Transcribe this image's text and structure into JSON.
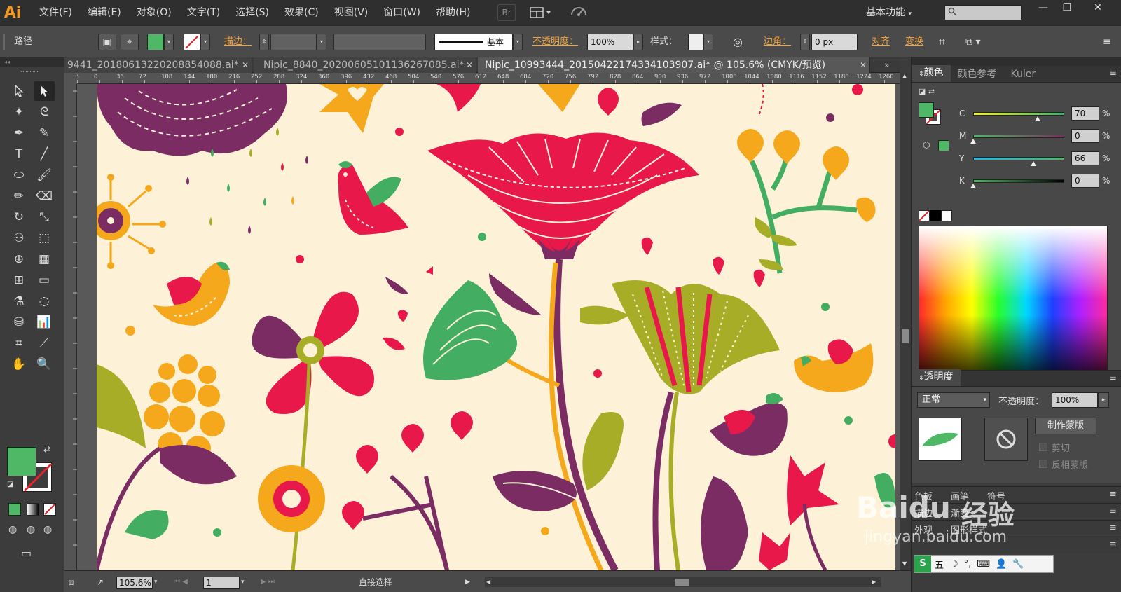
{
  "app": {
    "logo": "Ai",
    "workspace": "基本功能",
    "search_placeholder": ""
  },
  "menu": [
    "文件(F)",
    "编辑(E)",
    "对象(O)",
    "文字(T)",
    "选择(S)",
    "效果(C)",
    "视图(V)",
    "窗口(W)",
    "帮助(H)"
  ],
  "menu_icons": {
    "bridge": "Br",
    "arrange": "arrange-icon",
    "gpu": "gpu-icon"
  },
  "window_controls": [
    "—",
    "❐",
    "✕"
  ],
  "control": {
    "selection_type": "路径",
    "stroke_label": "描边：",
    "stroke_style": "基本",
    "opacity_label": "不透明度：",
    "opacity_value": "100%",
    "style_label": "样式：",
    "corner_label": "边角：",
    "corner_value": "0 px",
    "align_label": "对齐",
    "transform_label": "变换",
    "fill_color": "#4eb866"
  },
  "tabs": [
    {
      "label": "9441_20180613220208854088.ai*",
      "close": "✕"
    },
    {
      "label": "Nipic_8840_20200605101136267085.ai*",
      "close": "✕"
    },
    {
      "label": "Nipic_10993444_20150422174334103907.ai* @ 105.6% (CMYK/预览)",
      "close": "✕"
    }
  ],
  "ruler": {
    "top_ticks": [
      "36",
      "0",
      "36",
      "72",
      "108",
      "144",
      "180",
      "216",
      "252",
      "288",
      "324",
      "360",
      "396",
      "432",
      "468",
      "504",
      "540",
      "576",
      "612",
      "648",
      "684",
      "720",
      "756",
      "792",
      "828",
      "864",
      "900",
      "936",
      "972",
      "1008",
      "1044",
      "1080",
      "1116",
      "1152",
      "1188",
      "1224",
      "1260"
    ]
  },
  "statusbar": {
    "zoom": "105.6%",
    "artboard": "1",
    "tool_status": "直接选择"
  },
  "color_panel": {
    "tabs": [
      "颜色",
      "颜色参考",
      "Kuler"
    ],
    "channels": [
      {
        "name": "C",
        "value": "70",
        "unit": "%"
      },
      {
        "name": "M",
        "value": "0",
        "unit": "%"
      },
      {
        "name": "Y",
        "value": "66",
        "unit": "%"
      },
      {
        "name": "K",
        "value": "0",
        "unit": "%"
      }
    ],
    "fill": "#4eb866"
  },
  "transparency_panel": {
    "title": "透明度",
    "blend_mode": "正常",
    "opacity_label": "不透明度：",
    "opacity_value": "100%",
    "make_mask": "制作蒙版",
    "clip": "剪切",
    "invert_mask": "反相蒙版"
  },
  "collapsed_panels": [
    {
      "tabs": [
        "色板",
        "画笔",
        "符号"
      ]
    },
    {
      "tabs": [
        "描边",
        "渐变"
      ]
    },
    {
      "tabs": [
        "外观",
        "图形样式"
      ]
    },
    {
      "tabs": []
    }
  ],
  "watermark": {
    "brand": "Baidu",
    "suffix": "经验",
    "url": "jingyan.baidu.com"
  },
  "ime_bar": {
    "items": [
      "S",
      "五",
      "☽",
      "°,",
      "⌨",
      "👤",
      "🔧"
    ]
  },
  "colors": {
    "pink": "#e8194a",
    "purple": "#7b2d63",
    "orange": "#f5a81c",
    "green": "#43ad62",
    "olive": "#a7ad26",
    "cream": "#fdf1d8"
  }
}
